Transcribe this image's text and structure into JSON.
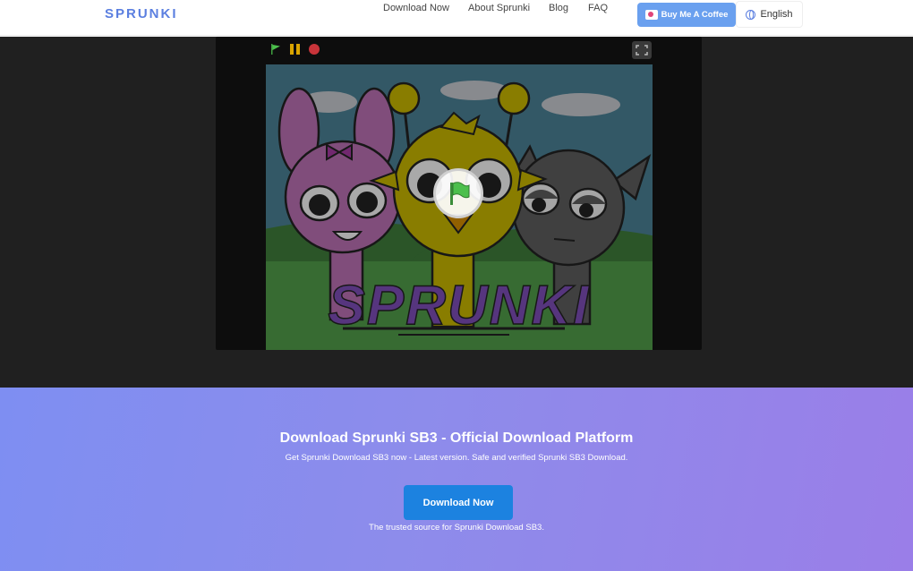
{
  "header": {
    "brand": "SPRUNKI",
    "nav": [
      "Download Now",
      "About Sprunki",
      "Blog",
      "FAQ"
    ],
    "coffee_label": "Buy Me A Coffee",
    "language_label": "English"
  },
  "game": {
    "logo_text": "SPRUNKI",
    "controls": [
      "green-flag",
      "pause",
      "stop",
      "fullscreen"
    ]
  },
  "hero": {
    "title": "Download Sprunki SB3 - Official Download Platform",
    "subtitle": "Get Sprunki Download SB3 now - Latest version. Safe and verified Sprunki SB3 Download.",
    "cta_label": "Download Now",
    "note": "The trusted source for Sprunki Download SB3."
  },
  "colors": {
    "brand": "#5b7fe0",
    "coffee_button": "#6aa0ef",
    "cta": "#1c82e0",
    "dark_bg": "#202020",
    "hero_gradient_start": "#7e8ef2",
    "hero_gradient_end": "#9a7ee8"
  }
}
